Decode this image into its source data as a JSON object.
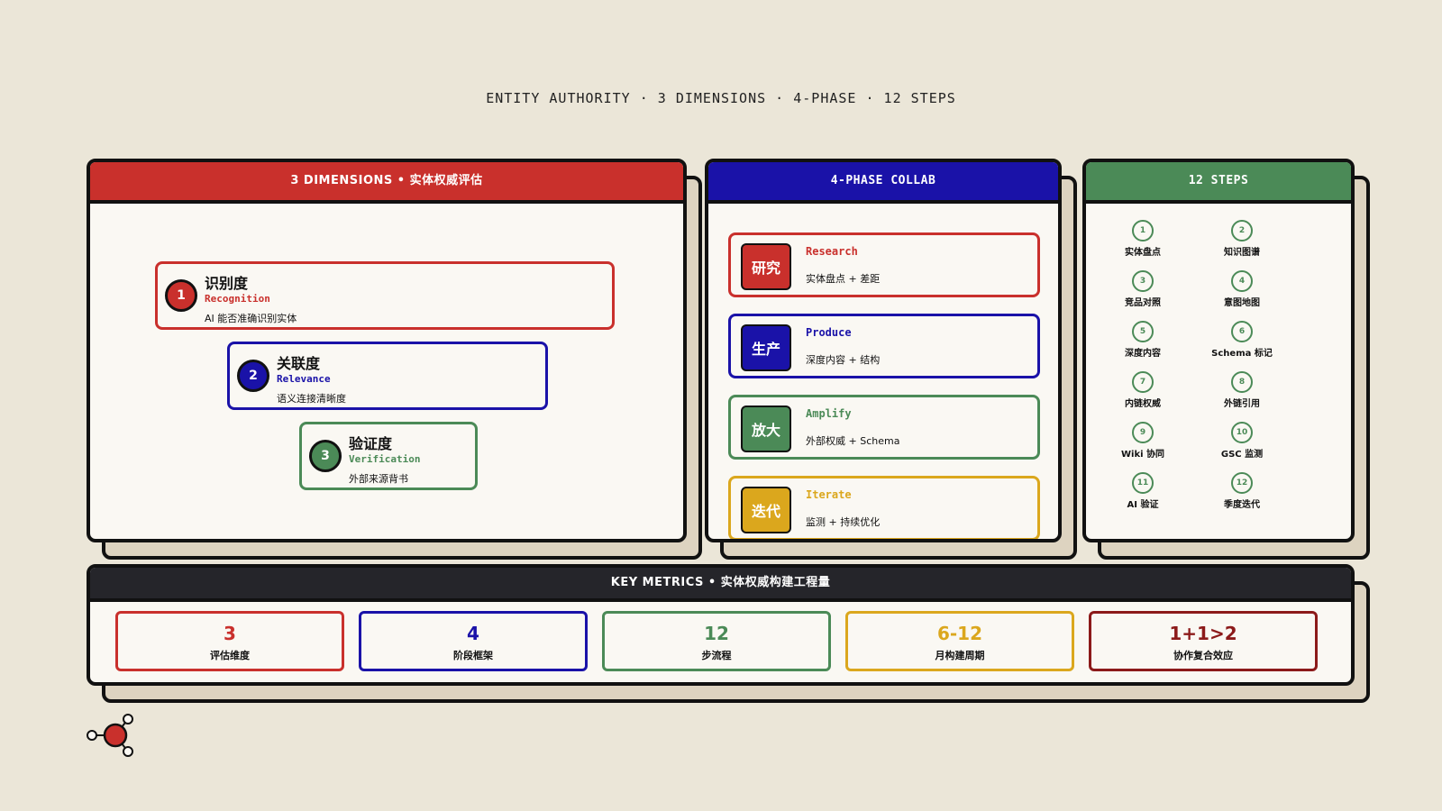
{
  "title": "ENTITY AUTHORITY · 3 DIMENSIONS · 4-PHASE · 12 STEPS",
  "colors": {
    "red": "#c9302c",
    "blue": "#1a12a8",
    "green": "#4b8a57",
    "yellow": "#dba71d",
    "darkred": "#8c1a1a",
    "dark": "#25252a",
    "background": "#ebe6d8"
  },
  "dimensions": {
    "header": "3 DIMENSIONS • 实体权威评估",
    "items": [
      {
        "num": "1",
        "title": "识别度",
        "en": "Recognition",
        "desc": "AI 能否准确识别实体"
      },
      {
        "num": "2",
        "title": "关联度",
        "en": "Relevance",
        "desc": "语义连接清晰度"
      },
      {
        "num": "3",
        "title": "验证度",
        "en": "Verification",
        "desc": "外部来源背书"
      }
    ]
  },
  "phases": {
    "header": "4-PHASE COLLAB",
    "items": [
      {
        "badge": "研究",
        "en": "Research",
        "desc": "实体盘点 + 差距"
      },
      {
        "badge": "生产",
        "en": "Produce",
        "desc": "深度内容 + 结构"
      },
      {
        "badge": "放大",
        "en": "Amplify",
        "desc": "外部权威 + Schema"
      },
      {
        "badge": "迭代",
        "en": "Iterate",
        "desc": "监测 + 持续优化"
      }
    ]
  },
  "steps": {
    "header": "12 STEPS",
    "items": [
      {
        "num": "1",
        "label": "实体盘点"
      },
      {
        "num": "2",
        "label": "知识图谱"
      },
      {
        "num": "3",
        "label": "竞品对照"
      },
      {
        "num": "4",
        "label": "意图地图"
      },
      {
        "num": "5",
        "label": "深度内容"
      },
      {
        "num": "6",
        "label": "Schema 标记"
      },
      {
        "num": "7",
        "label": "内链权威"
      },
      {
        "num": "8",
        "label": "外链引用"
      },
      {
        "num": "9",
        "label": "Wiki 协同"
      },
      {
        "num": "10",
        "label": "GSC 监测"
      },
      {
        "num": "11",
        "label": "AI 验证"
      },
      {
        "num": "12",
        "label": "季度迭代"
      }
    ]
  },
  "metrics": {
    "header": "KEY METRICS • 实体权威构建工程量",
    "items": [
      {
        "value": "3",
        "label": "评估维度"
      },
      {
        "value": "4",
        "label": "阶段框架"
      },
      {
        "value": "12",
        "label": "步流程"
      },
      {
        "value": "6-12",
        "label": "月构建周期"
      },
      {
        "value": "1+1>2",
        "label": "协作复合效应"
      }
    ]
  },
  "icons": {
    "logo": "molecule-logo-icon"
  }
}
